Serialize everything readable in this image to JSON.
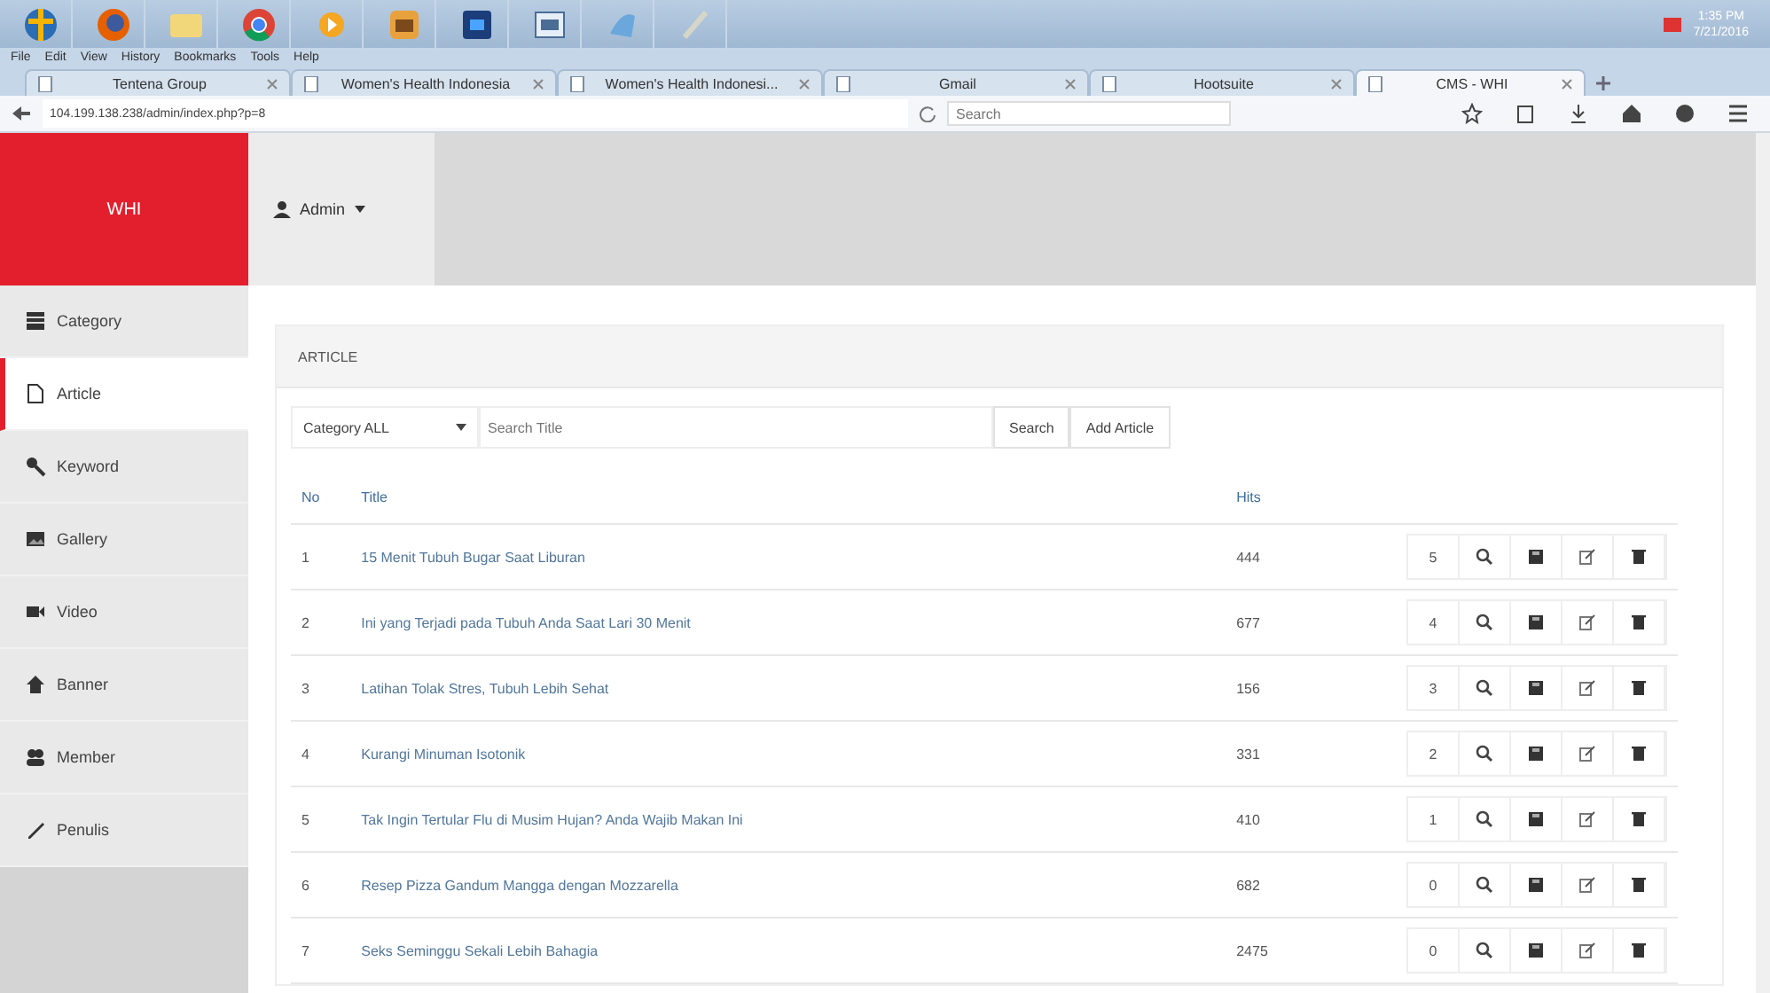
{
  "taskbar": {
    "clock": {
      "time": "1:35 PM",
      "date": "7/21/2016"
    }
  },
  "browser": {
    "menu": [
      "File",
      "Edit",
      "View",
      "History",
      "Bookmarks",
      "Tools",
      "Help"
    ],
    "tabs": [
      {
        "label": "Tentena Group",
        "selected": false
      },
      {
        "label": "Women's Health Indonesia",
        "selected": false
      },
      {
        "label": "Women's Health Indonesi...",
        "selected": false
      },
      {
        "label": "Gmail",
        "selected": false
      },
      {
        "label": "Hootsuite",
        "selected": false
      },
      {
        "label": "CMS - WHI",
        "selected": true
      }
    ],
    "address": "104.199.138.238/admin/index.php?p=8",
    "search": {
      "placeholder": "Search"
    }
  },
  "sidebar": {
    "brand": "WHI",
    "items": [
      {
        "label": "Category",
        "kind": "grid",
        "selected": false
      },
      {
        "label": "Article",
        "kind": "page",
        "selected": true
      },
      {
        "label": "Keyword",
        "kind": "key",
        "selected": false
      },
      {
        "label": "Gallery",
        "kind": "image",
        "selected": false
      },
      {
        "label": "Video",
        "kind": "video",
        "selected": false
      },
      {
        "label": "Banner",
        "kind": "home",
        "selected": false
      },
      {
        "label": "Member",
        "kind": "users",
        "selected": false
      },
      {
        "label": "Penulis",
        "kind": "pen",
        "selected": false
      }
    ]
  },
  "topbar": {
    "user": "Admin"
  },
  "panel": {
    "title": "ARTICLE",
    "category_select": "Category ALL",
    "search": {
      "placeholder": "Search Title"
    },
    "buttons": [
      "Search",
      "Add Article"
    ],
    "table": {
      "columns": [
        "No",
        "Title",
        "Hits"
      ],
      "rows": [
        {
          "no": "1",
          "title": "15 Menit Tubuh Bugar Saat Liburan",
          "hits": "444",
          "count": "5"
        },
        {
          "no": "2",
          "title": "Ini yang Terjadi pada Tubuh Anda Saat Lari 30 Menit",
          "hits": "677",
          "count": "4"
        },
        {
          "no": "3",
          "title": "Latihan Tolak Stres, Tubuh Lebih Sehat",
          "hits": "156",
          "count": "3"
        },
        {
          "no": "4",
          "title": "Kurangi Minuman Isotonik",
          "hits": "331",
          "count": "2"
        },
        {
          "no": "5",
          "title": "Tak Ingin Tertular Flu di Musim Hujan? Anda Wajib Makan Ini",
          "hits": "410",
          "count": "1"
        },
        {
          "no": "6",
          "title": "Resep Pizza Gandum Mangga dengan Mozzarella",
          "hits": "682",
          "count": "0"
        },
        {
          "no": "7",
          "title": "Seks Seminggu Sekali Lebih Bahagia",
          "hits": "2475",
          "count": "0"
        }
      ]
    }
  }
}
